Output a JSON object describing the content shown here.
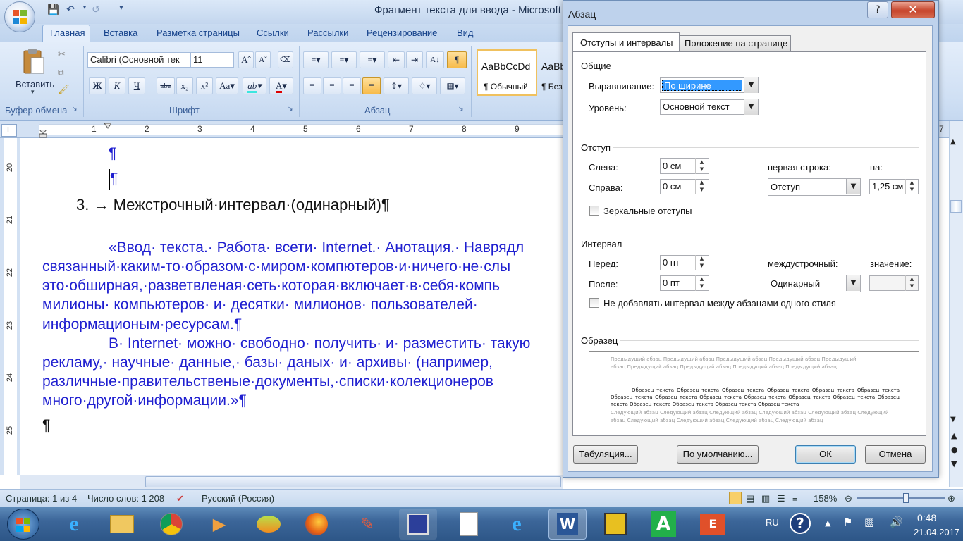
{
  "window": {
    "title": "Фрагмент текста для ввода - Microsoft",
    "tabs": [
      "Главная",
      "Вставка",
      "Разметка страницы",
      "Ссылки",
      "Рассылки",
      "Рецензирование",
      "Вид"
    ]
  },
  "ribbon": {
    "paste_label": "Вставить",
    "groups": [
      "Буфер обмена",
      "Шрифт",
      "Абзац"
    ],
    "font_name": "Calibri (Основной тек",
    "font_size": "11",
    "bold": "Ж",
    "italic": "К",
    "underline": "Ч",
    "strike": "abe",
    "styles": [
      "AaBbCcDd",
      "AaBb"
    ],
    "style_names": [
      "¶ Обычный",
      "¶ Без"
    ]
  },
  "ruler": {
    "numbers": [
      "1",
      "2",
      "3",
      "4",
      "5",
      "6",
      "7",
      "8",
      "9",
      "7"
    ]
  },
  "vruler": {
    "numbers": [
      "20",
      "21",
      "22",
      "23",
      "24",
      "25"
    ]
  },
  "document": {
    "pilcrow1": "¶",
    "pilcrow2": "¶",
    "heading": "3. → Межстрочный·интервал·(одинарный)¶",
    "lines": [
      "«Ввод· текста.· Работа· всети· Internet.· Анотация.· Наврядл",
      "связанный·каким-то·образом·с·миром·компютеров·и·ничего·не·слы",
      "это·обширная,·разветвленая·сеть·которая·включает·в·себя·компь",
      "милионы·  компьютеров·  и·  десятки·  милионов·  пользователей·",
      "информационым·ресурсам.¶",
      "В· Internet· можно· свободно· получить· и· разместить· такую",
      "рекламу,·  научные·  данные,·  базы·  даных·  и·  архивы·  (например,",
      "различные·правительственые·документы,·списки·колекционеров",
      "много·другой·информации.»¶"
    ],
    "pilcrow3": "¶"
  },
  "status": {
    "page": "Страница: 1 из 4",
    "words": "Число слов: 1 208",
    "lang": "Русский (Россия)",
    "zoom": "158%"
  },
  "taskbar": {
    "lang": "RU",
    "time": "0:48",
    "date": "21.04.2017"
  },
  "dialog": {
    "title": "Абзац",
    "tabs": [
      "Отступы и интервалы",
      "Положение на странице"
    ],
    "general": "Общие",
    "align_label": "Выравнивание:",
    "align_value": "По ширине",
    "level_label": "Уровень:",
    "level_value": "Основной текст",
    "indent": "Отступ",
    "left_label": "Слева:",
    "left_value": "0 см",
    "right_label": "Справа:",
    "right_value": "0 см",
    "first_line_label": "первая строка:",
    "first_line_value": "Отступ",
    "on_label": "на:",
    "on_value": "1,25 см",
    "mirror_label": "Зеркальные отступы",
    "interval": "Интервал",
    "before_label": "Перед:",
    "before_value": "0 пт",
    "after_label": "После:",
    "after_value": "0 пт",
    "line_label": "междустрочный:",
    "line_value": "Одинарный",
    "value_label": "значение:",
    "value_value": "",
    "no_space_label": "Не добавлять интервал между абзацами одного стиля",
    "sample": "Образец",
    "preview_prev": "Предыдущий абзац Предыдущий абзац Предыдущий абзац Предыдущий абзац Предыдущий абзац Предыдущий абзац Предыдущий абзац Предыдущий абзац Предыдущий абзац",
    "preview_text": "Образец текста Образец текста Образец текста Образец текста Образец текста Образец текста Образец текста Образец текста Образец текста Образец текста Образец текста Образец текста Образец текста Образец текста Образец текста Образец текста Образец текста",
    "preview_next": "Следующий абзац Следующий абзац Следующий абзац Следующий абзац Следующий абзац Следующий абзац Следующий абзац Следующий абзац Следующий абзац Следующий абзац",
    "btn_tabs": "Табуляция...",
    "btn_default": "По умолчанию...",
    "btn_ok": "ОК",
    "btn_cancel": "Отмена"
  },
  "colors": {
    "doc_text": "#1f1fd0",
    "accent": "#15428b",
    "dialog_frame": "#bed2ec"
  }
}
